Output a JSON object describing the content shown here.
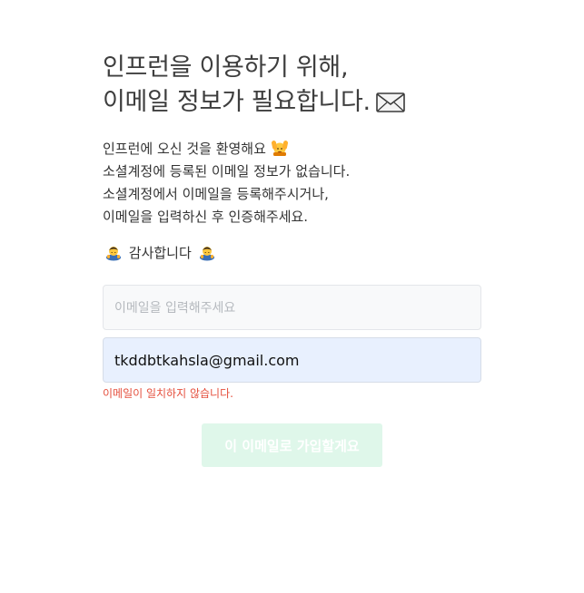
{
  "title": {
    "line1": "인프런을 이용하기 위해,",
    "line2": "이메일 정보가 필요합니다."
  },
  "intro": {
    "line1": "인프런에 오신 것을 환영해요",
    "line2": "소셜계정에 등록된 이메일 정보가 없습니다.",
    "line3": "소셜계정에서 이메일을 등록해주시거나,",
    "line4": "이메일을 입력하신 후 인증해주세요."
  },
  "thanks": "감사합니다",
  "icons": {
    "title": "envelope-icon",
    "welcome": "raising-hands-icon",
    "thanks": "bowing-person-icon"
  },
  "form": {
    "email_placeholder": "이메일을 입력해주세요",
    "email_confirm_value": "tkddbtkahsla@gmail.com",
    "error_message": "이메일이 일치하지 않습니다.",
    "submit_label": "이 이메일로 가입할게요"
  },
  "colors": {
    "error": "#e5503e",
    "submit_disabled_bg": "#dff7ea",
    "filled_input_bg": "#e8f0fe"
  }
}
